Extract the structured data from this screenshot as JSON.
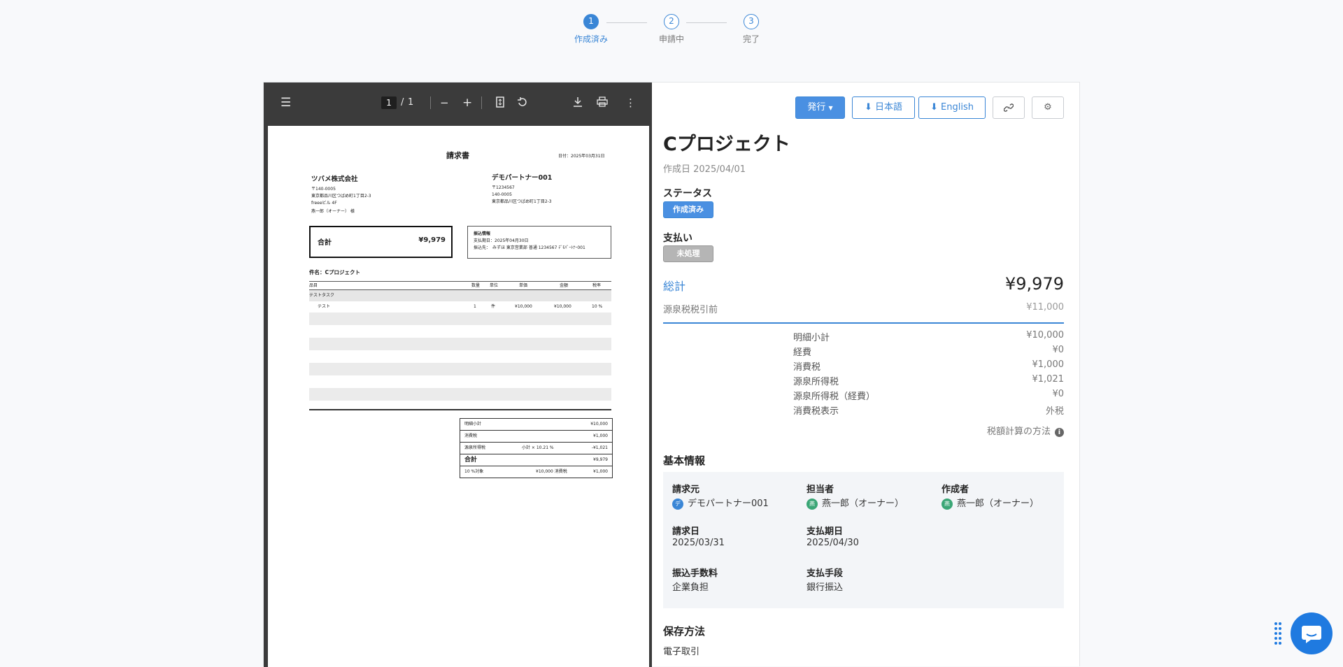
{
  "stepper": {
    "steps": [
      {
        "num": "1",
        "label": "作成済み"
      },
      {
        "num": "2",
        "label": "申請中"
      },
      {
        "num": "3",
        "label": "完了"
      }
    ]
  },
  "viewer": {
    "page_current": "1",
    "page_sep": "/",
    "page_total": "1"
  },
  "invoice": {
    "title": "請求書",
    "date": "日付：2025年03月31日",
    "company": "ツバメ株式会社",
    "company_addr": [
      "〒140-0005",
      "東京都品川区つばめ町1丁目2-3",
      "freeeビル 4F",
      "燕一郎（オーナー） 様"
    ],
    "partner": "デモパートナー001",
    "partner_addr": [
      "〒1234567",
      "140-0005",
      "東京都品川区つばめ町1丁目2-3"
    ],
    "total_label": "合計",
    "total_value": "¥9,979",
    "bank_title": "振込情報",
    "bank_due": "支払期日：2025年04月30日",
    "bank_to": "振込先：　みずほ 東京営業部 普通 1234567 ﾃﾞﾓﾊﾟｰﾄﾅｰ001",
    "subject": "件名：Cプロジェクト",
    "headers": [
      "品目",
      "数量",
      "単位",
      "単価",
      "金額",
      "税率"
    ],
    "group": "テストタスク",
    "item": {
      "name": "テスト",
      "qty": "1",
      "unit": "件",
      "price": "¥10,000",
      "amount": "¥10,000",
      "rate": "10 %"
    },
    "summary": {
      "subtotal_label": "明細小計",
      "subtotal": "¥10,000",
      "tax_label": "消費税",
      "tax": "¥1,000",
      "wh_label": "源泉所得税",
      "wh_note": "小計 × 10.21 %",
      "wh": "-¥1,021",
      "total_label": "合計",
      "total": "¥9,979",
      "rate_label": "10 %対象",
      "rate_base": "¥10,000 消費税",
      "rate_tax": "¥1,000"
    }
  },
  "actions": {
    "issue": "発行",
    "jp": "日本語",
    "en": "English"
  },
  "detail": {
    "title": "Cプロジェクト",
    "created": "作成日 2025/04/01",
    "status_label": "ステータス",
    "status_badge": "作成済み",
    "payment_label": "支払い",
    "payment_badge": "未処理",
    "total_label": "総計",
    "total_value": "¥9,979",
    "pretax_label": "源泉税税引前",
    "pretax_value": "¥11,000",
    "breakdown": [
      {
        "label": "明細小計",
        "value": "¥10,000"
      },
      {
        "label": "経費",
        "value": "¥0"
      },
      {
        "label": "消費税",
        "value": "¥1,000"
      },
      {
        "label": "源泉所得税",
        "value": "¥1,021"
      },
      {
        "label": "源泉所得税（経費）",
        "value": "¥0"
      },
      {
        "label": "消費税表示",
        "value": "外税"
      }
    ],
    "calc_link": "税額計算の方法",
    "basic_title": "基本情報",
    "billing_from_label": "請求元",
    "billing_from": "デモパートナー001",
    "billing_from_avatar": "デ",
    "assignee_label": "担当者",
    "assignee": "燕一郎（オーナー）",
    "creator_label": "作成者",
    "creator": "燕一郎（オーナー）",
    "person_avatar": "燕",
    "invoice_date_label": "請求日",
    "invoice_date": "2025/03/31",
    "due_label": "支払期日",
    "due": "2025/04/30",
    "fee_label": "振込手数料",
    "fee": "企業負担",
    "method_label": "支払手段",
    "method": "銀行振込",
    "storage_title": "保存方法",
    "storage": "電子取引"
  },
  "colors": {
    "accent": "#3a86d6",
    "status_created": "#4a90e2",
    "status_unprocessed": "#b5b5b5",
    "avatar_partner": "#3a86d6",
    "avatar_person": "#3aa676"
  }
}
